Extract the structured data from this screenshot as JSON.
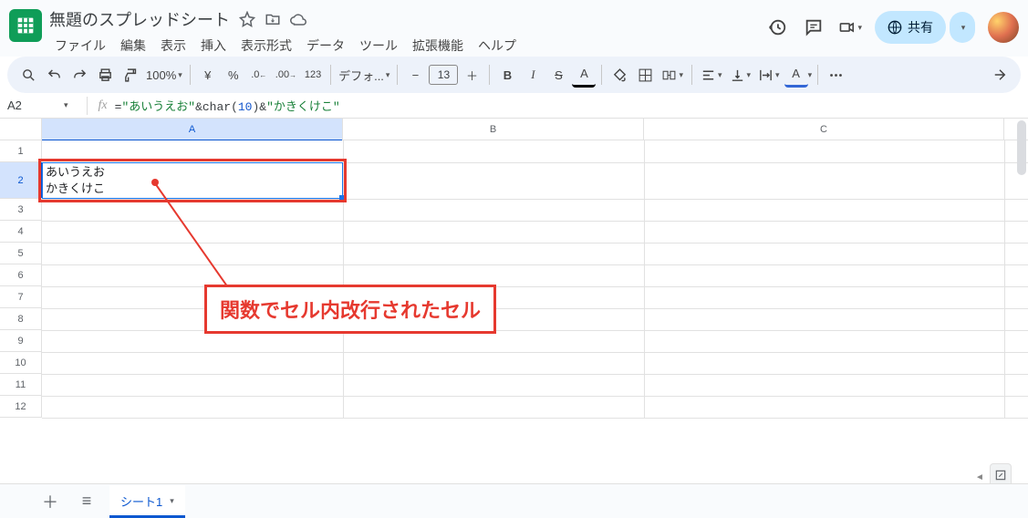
{
  "doc": {
    "title": "無題のスプレッドシート"
  },
  "menubar": [
    "ファイル",
    "編集",
    "表示",
    "挿入",
    "表示形式",
    "データ",
    "ツール",
    "拡張機能",
    "ヘルプ"
  ],
  "share": {
    "label": "共有"
  },
  "toolbar": {
    "zoom": "100%",
    "currency": "¥",
    "percent": "%",
    "font": "デフォ...",
    "fontsize": "13",
    "bold": "B",
    "italic": "I",
    "strike": "S",
    "textcolor": "A",
    "altcolor": "A",
    "fmt123": "123"
  },
  "fbar": {
    "namebox": "A2",
    "formula_seg1": "=",
    "formula_seg2": "\"あいうえお\"",
    "formula_seg3": "&char(",
    "formula_seg4": "10",
    "formula_seg5": ")&",
    "formula_seg6": "\"かきくけこ\""
  },
  "grid": {
    "cols": [
      "A",
      "B",
      "C"
    ],
    "rows": [
      "1",
      "2",
      "3",
      "4",
      "5",
      "6",
      "7",
      "8",
      "9",
      "10",
      "11",
      "12"
    ],
    "cell_a2": "あいうえお\nかきくけこ"
  },
  "annotation": {
    "callout": "関数でセル内改行されたセル"
  },
  "sheetbar": {
    "tab1": "シート1"
  }
}
